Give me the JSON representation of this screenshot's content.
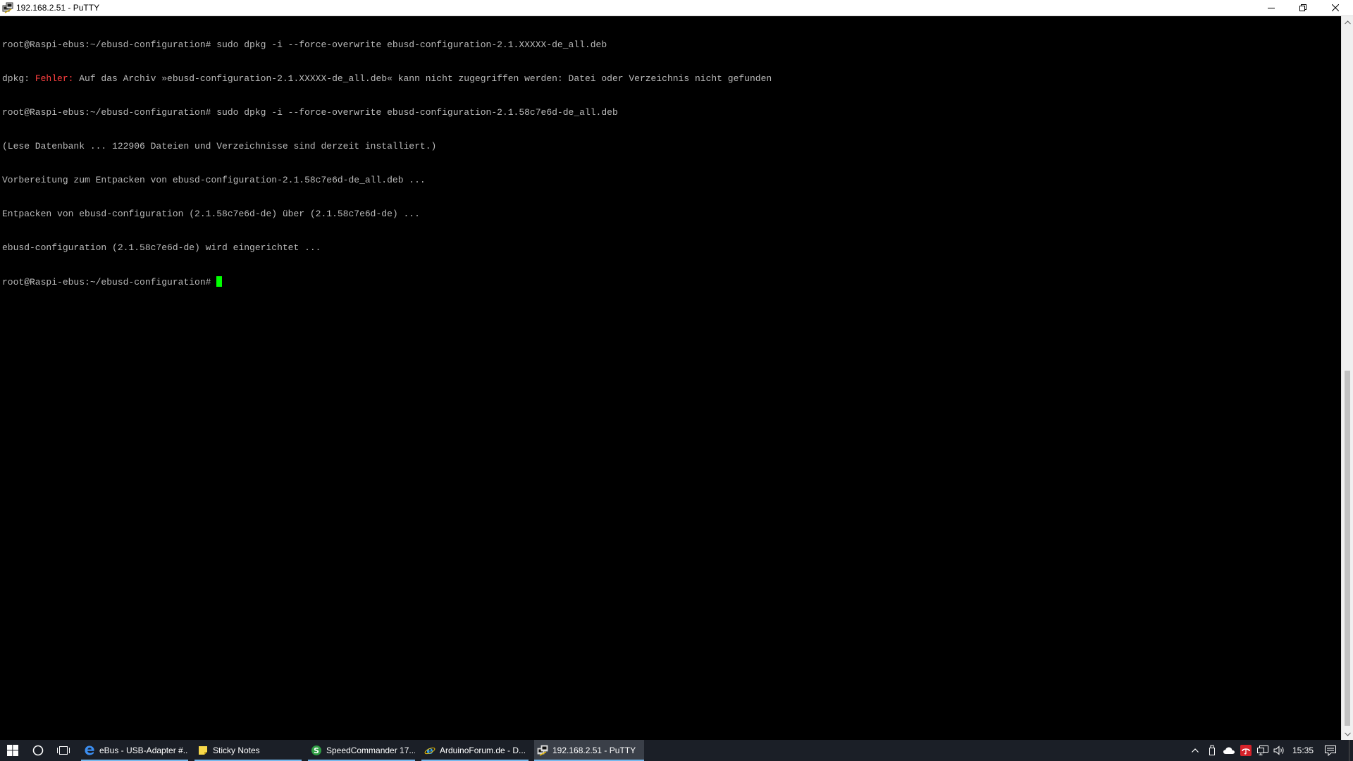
{
  "window": {
    "title": "192.168.2.51 - PuTTY"
  },
  "terminal": {
    "line1": "root@Raspi-ebus:~/ebusd-configuration# sudo dpkg -i --force-overwrite ebusd-configuration-2.1.XXXXX-de_all.deb",
    "line2_prefix": "dpkg: ",
    "line2_error": "Fehler:",
    "line2_rest": " Auf das Archiv »ebusd-configuration-2.1.XXXXX-de_all.deb« kann nicht zugegriffen werden: Datei oder Verzeichnis nicht gefunden",
    "line3": "root@Raspi-ebus:~/ebusd-configuration# sudo dpkg -i --force-overwrite ebusd-configuration-2.1.58c7e6d-de_all.deb",
    "line4": "(Lese Datenbank ... 122906 Dateien und Verzeichnisse sind derzeit installiert.)",
    "line5": "Vorbereitung zum Entpacken von ebusd-configuration-2.1.58c7e6d-de_all.deb ...",
    "line6": "Entpacken von ebusd-configuration (2.1.58c7e6d-de) über (2.1.58c7e6d-de) ...",
    "line7": "ebusd-configuration (2.1.58c7e6d-de) wird eingerichtet ...",
    "prompt": "root@Raspi-ebus:~/ebusd-configuration# ",
    "error_color": "#ff4040",
    "cursor_color": "#00ff00"
  },
  "taskbar": {
    "tasks": [
      {
        "label": "eBus - USB-Adapter #...",
        "icon": "edge-icon"
      },
      {
        "label": "Sticky Notes",
        "icon": "sticky-notes-icon"
      },
      {
        "label": "SpeedCommander 17...",
        "icon": "speedcommander-icon"
      },
      {
        "label": "ArduinoForum.de - D...",
        "icon": "internet-explorer-icon"
      },
      {
        "label": "192.168.2.51 - PuTTY",
        "icon": "putty-icon"
      }
    ],
    "clock": "15:35",
    "accent": "#76b9ed"
  }
}
